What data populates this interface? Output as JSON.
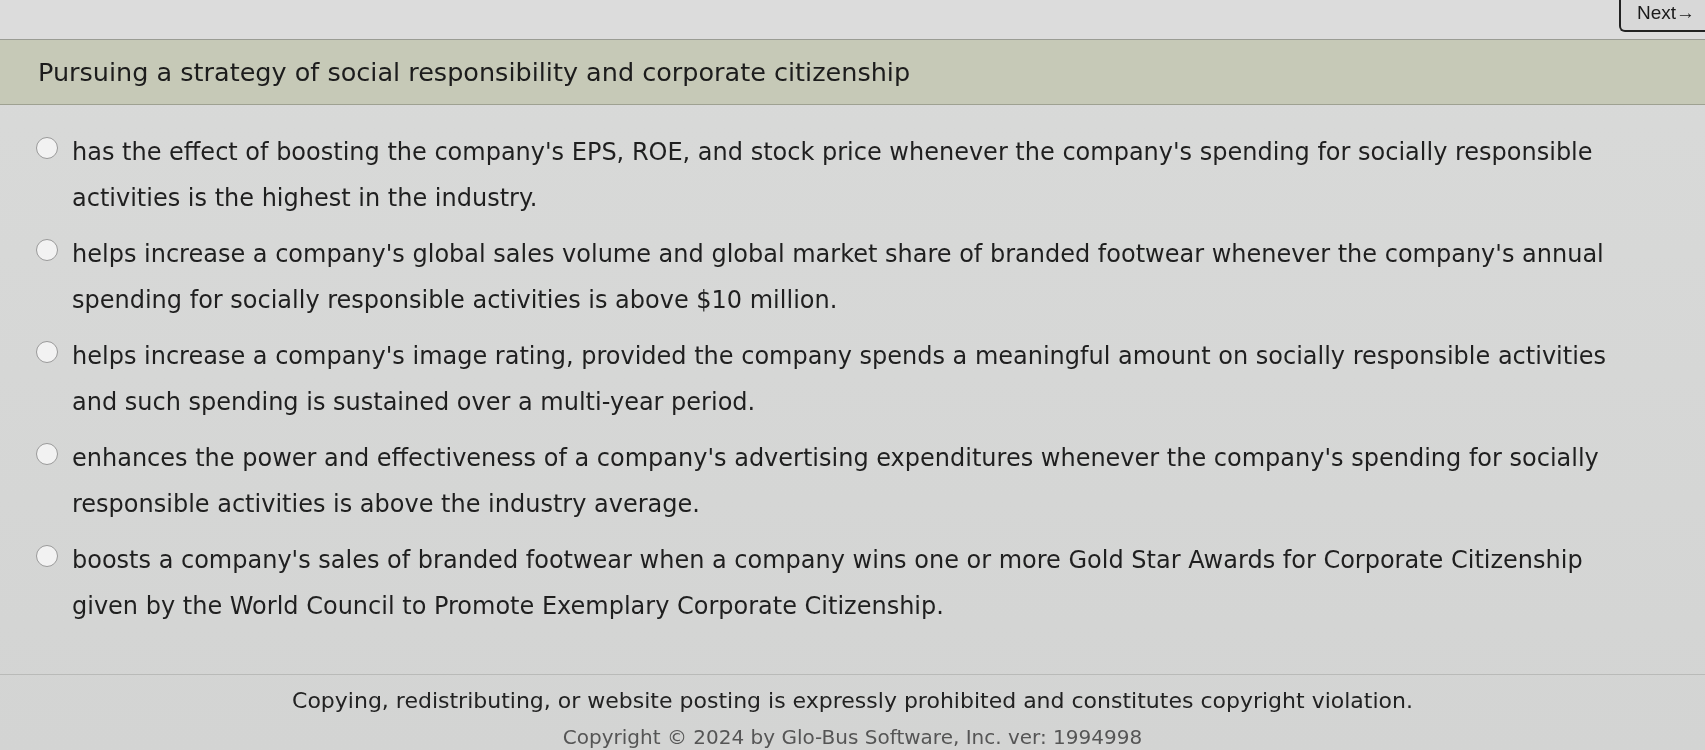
{
  "navigation": {
    "next_button": "Next→"
  },
  "question": {
    "prompt": "Pursuing a strategy of social responsibility and corporate citizenship",
    "options": [
      {
        "text": "has the effect of boosting the company's EPS, ROE, and stock price whenever the company's spending for socially responsible activities is the highest in the industry.",
        "selected": false
      },
      {
        "text": "helps increase a company's global sales volume and global market share of branded footwear whenever the company's annual spending for socially responsible activities is above $10 million.",
        "selected": false
      },
      {
        "text": "helps increase a company's image rating, provided the company spends a meaningful amount on socially responsible activities and such spending is sustained over a multi-year period.",
        "selected": false
      },
      {
        "text": "enhances the power and effectiveness of a company's advertising expenditures whenever the company's spending for socially responsible activities is above the industry average.",
        "selected": false
      },
      {
        "text": "boosts a company's sales of branded footwear when a company wins one or more Gold Star Awards for Corporate Citizenship given by the World Council to Promote Exemplary Corporate Citizenship.",
        "selected": false
      }
    ]
  },
  "footer": {
    "notice": "Copying, redistributing, or website posting is expressly prohibited and constitutes copyright violation.",
    "copyright": "Copyright © 2024 by Glo-Bus Software, Inc. ver: 1994998"
  }
}
